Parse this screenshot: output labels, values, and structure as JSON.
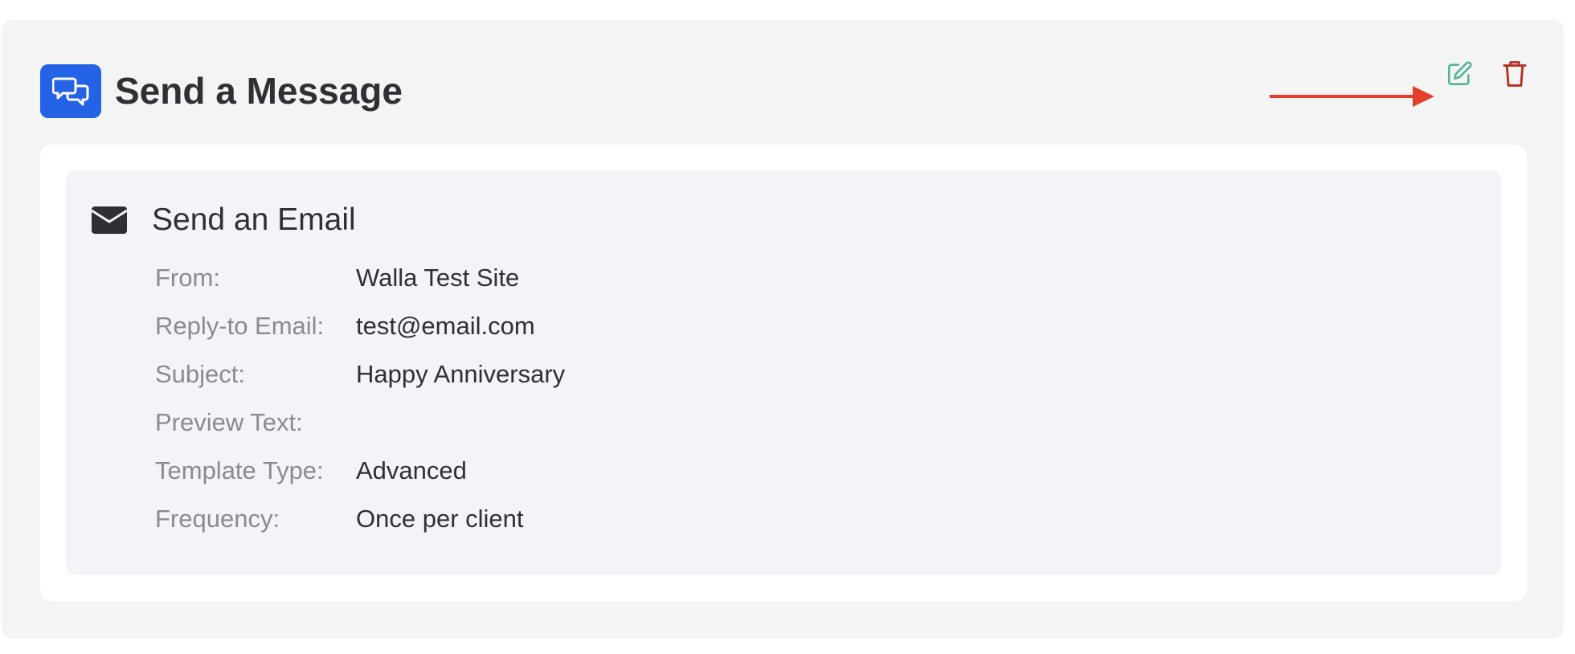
{
  "header": {
    "title": "Send a Message",
    "icon": "chat-bubbles-icon",
    "icon_bg_color": "#2563e6"
  },
  "actions": {
    "edit_icon": "edit-icon",
    "edit_color": "#4fb396",
    "delete_icon": "trash-icon",
    "delete_color": "#b3321f"
  },
  "annotation": {
    "arrow_color": "#e3402c",
    "points_to": "edit-button"
  },
  "email": {
    "title": "Send an Email",
    "icon": "envelope-icon",
    "details": [
      {
        "label": "From:",
        "value": "Walla Test Site"
      },
      {
        "label": "Reply-to Email:",
        "value": "test@email.com"
      },
      {
        "label": "Subject:",
        "value": "Happy Anniversary"
      },
      {
        "label": "Preview Text:",
        "value": ""
      },
      {
        "label": "Template Type:",
        "value": "Advanced"
      },
      {
        "label": "Frequency:",
        "value": "Once per client"
      }
    ]
  }
}
